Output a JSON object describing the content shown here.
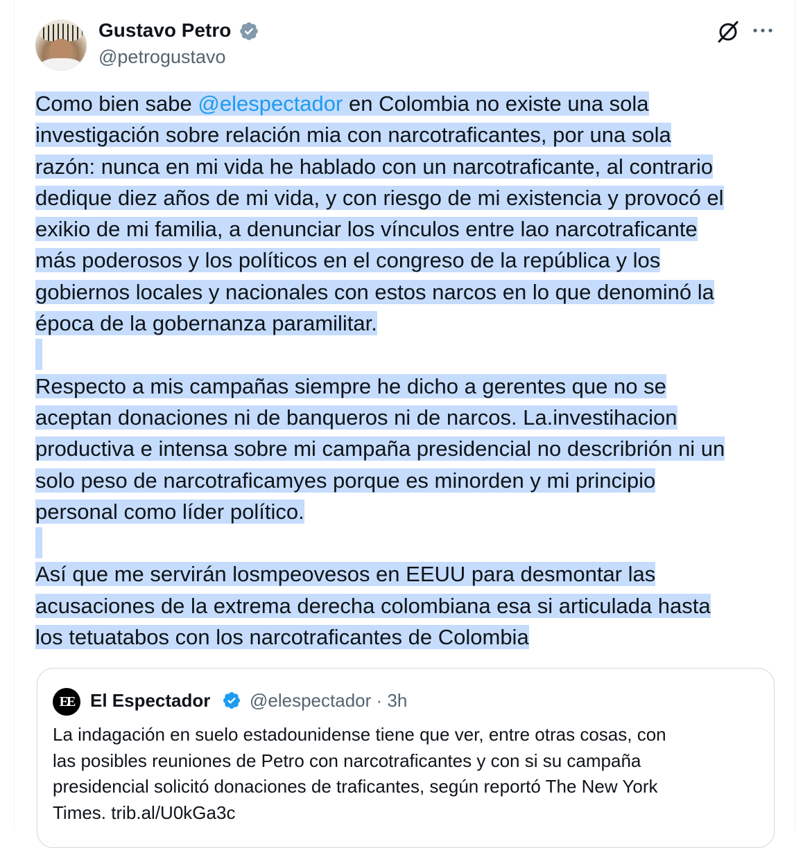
{
  "author": {
    "name": "Gustavo Petro",
    "handle": "@petrogustavo"
  },
  "icons": {
    "verified": "verified-badge-icon",
    "grok": "grok-icon",
    "more": "more-options-icon"
  },
  "colors": {
    "selection_highlight": "#c6dcfc",
    "link": "#1d9bf0",
    "verified_badge": "#829aab",
    "quoted_verified_badge": "#1d9bf0"
  },
  "tweet": {
    "paragraph1": {
      "line1_before": "Como bien sabe ",
      "mention": "@elespectador",
      "line1_after": " en Colombia no existe una sola",
      "lines": [
        "investigación sobre relación mia con narcotraficantes, por una sola",
        "razón: nunca en mi vida he  hablado con un narcotraficante, al contrario",
        "dedique diez años de mi vida, y con riesgo de mi existencia y provocó el",
        "exikio de mi familia, a denunciar los vínculos entre lao narcotraficante",
        "más poderosos y los políticos en el congreso de la república y los",
        "gobiernos locales y nacionales con estos narcos en lo que denominó la",
        "época de la gobernanza paramilitar."
      ]
    },
    "paragraph2": {
      "lines": [
        "Respecto a mis campañas siempre he dicho a gerentes que no se",
        "aceptan donaciones ni de banqueros ni de narcos. La.investihacion",
        "productiva e intensa sobre mi campaña presidencial no describrión ni un",
        "solo peso de narcotraficamyes porque es minorden y mi principio",
        "personal como líder político."
      ]
    },
    "paragraph3": {
      "lines": [
        "Así que me servirán losmpeovesos en EEUU para desmontar las",
        "acusaciones de la extrema derecha colombiana esa si articulada hasta",
        "los tetuatabos con los narcotraficantes de Colombia"
      ]
    }
  },
  "quoted": {
    "logo_text": "EE",
    "name": "El Espectador",
    "handle": "@elespectador",
    "separator": "·",
    "time": "3h",
    "lines": [
      "La indagación en suelo estadounidense tiene que ver, entre otras cosas, con",
      "las posibles reuniones de Petro con narcotraficantes y con si su campaña",
      "presidencial solicitó donaciones de traficantes, según reportó The New York",
      "Times. trib.al/U0kGa3c"
    ]
  }
}
